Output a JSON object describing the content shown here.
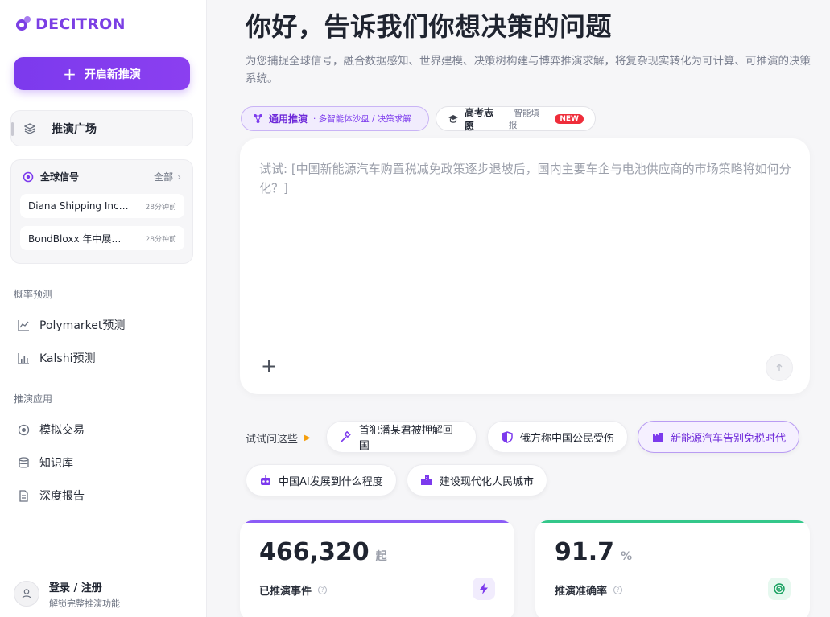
{
  "brand": {
    "name": "DECITRON",
    "color": "#7b3fe4"
  },
  "sidebar": {
    "new_button": "开启新推演",
    "plaza": "推演广场",
    "signals": {
      "title": "全球信号",
      "all": "全部",
      "items": [
        {
          "title": "Diana Shipping Inc. ...",
          "time": "28分钟前"
        },
        {
          "title": "BondBloxx 年中展望...",
          "time": "28分钟前"
        }
      ]
    },
    "section_prob": "概率预测",
    "prob_items": [
      {
        "label": "Polymarket预测",
        "icon": "line-chart-icon"
      },
      {
        "label": "Kalshi预测",
        "icon": "bar-chart-icon"
      }
    ],
    "section_apps": "推演应用",
    "app_items": [
      {
        "label": "模拟交易",
        "icon": "target-icon"
      },
      {
        "label": "知识库",
        "icon": "database-icon"
      },
      {
        "label": "深度报告",
        "icon": "document-icon"
      }
    ],
    "login": {
      "title": "登录 / 注册",
      "subtitle": "解锁完整推演功能"
    }
  },
  "main": {
    "title": "你好，告诉我们你想决策的问题",
    "description": "为您捕捉全球信号，融合数据感知、世界建模、决策树构建与博弈推演求解，将复杂现实转化为可计算、可推演的决策系统。",
    "modes": [
      {
        "label": "通用推演",
        "sub": "· 多智能体沙盘 / 决策求解"
      },
      {
        "label": "高考志愿",
        "sub": "· 智能填报",
        "badge": "NEW"
      }
    ],
    "input_placeholder": "试试: [中国新能源汽车购置税减免政策逐步退坡后，国内主要车企与电池供应商的市场策略将如何分化？]",
    "try_label": "试试问这些",
    "suggestions": [
      {
        "label": "首犯潘某君被押解回国",
        "icon": "gavel-icon"
      },
      {
        "label": "俄方称中国公民受伤",
        "icon": "shield-icon"
      },
      {
        "label": "新能源汽车告别免税时代",
        "icon": "factory-icon"
      },
      {
        "label": "中国AI发展到什么程度",
        "icon": "robot-icon"
      },
      {
        "label": "建设现代化人民城市",
        "icon": "city-icon"
      }
    ],
    "stats": [
      {
        "value": "466,320",
        "unit": "起",
        "label": "已推演事件",
        "color": "#8b5cf6"
      },
      {
        "value": "91.7",
        "unit": "%",
        "label": "推演准确率",
        "color": "#34c78a"
      }
    ]
  }
}
